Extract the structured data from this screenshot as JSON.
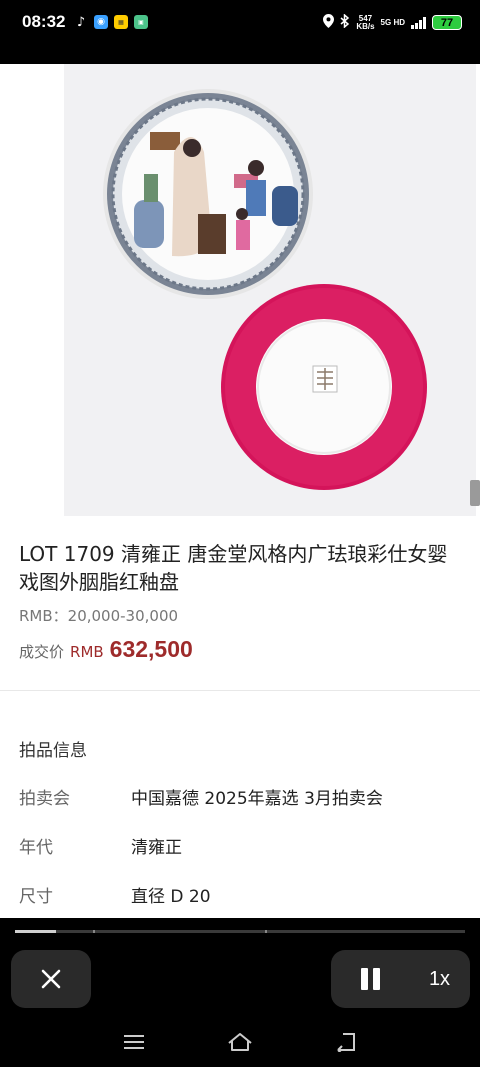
{
  "status_bar": {
    "time": "08:32",
    "app_icons": [
      "tiktok-icon",
      "app-icon-blue",
      "app-icon-yellow",
      "app-icon-green"
    ],
    "net_speed_value": "547",
    "net_speed_unit": "KB/s",
    "network_5g": "5G HD",
    "battery": "77"
  },
  "lot": {
    "title": "LOT 1709 清雍正  唐金堂风格内广珐琅彩仕女婴戏图外胭脂红釉盘",
    "estimate": "RMB：20,000-30,000",
    "sold_label": "成交价",
    "sold_currency": "RMB",
    "sold_price": "632,500"
  },
  "info": {
    "section_title": "拍品信息",
    "rows": [
      {
        "label": "拍卖会",
        "value": "中国嘉德 2025年嘉选 3月拍卖会"
      },
      {
        "label": "年代",
        "value": "清雍正"
      },
      {
        "label": "尺寸",
        "value": "直径  D 20"
      }
    ]
  },
  "player": {
    "progress_fraction": 0.09,
    "speed_label": "1x"
  },
  "colors": {
    "accent_price": "#9e2b2b",
    "plate_rim": "#d4145a",
    "battery": "#2ecc40"
  }
}
